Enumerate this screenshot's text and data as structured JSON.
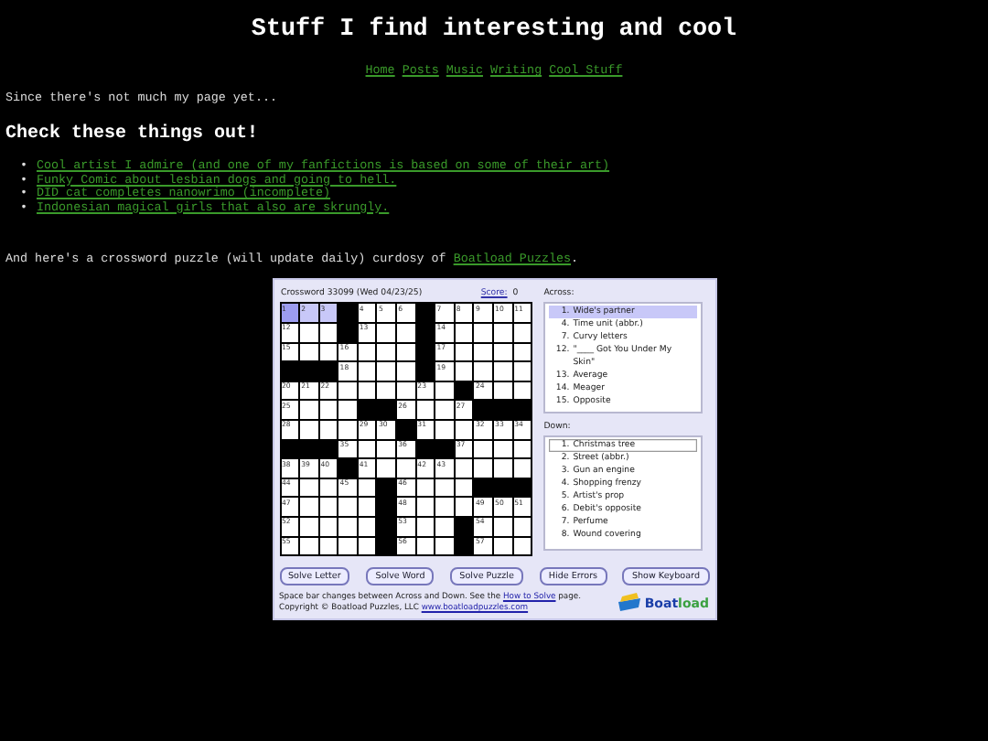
{
  "title": "Stuff I find interesting and cool",
  "nav": [
    "Home",
    "Posts",
    "Music",
    "Writing",
    "Cool Stuff"
  ],
  "intro": "Since there's not much my page yet...",
  "heading": "Check these things out!",
  "bullet": "•",
  "links": [
    "Cool artist I admire (and one of my fanfictions is based on some of their art)",
    "Funky Comic about lesbian dogs and going to hell.",
    "DID cat completes nanowrimo (incomplete)",
    "Indonesian magical girls that also are skrungly."
  ],
  "credit": {
    "text": "And here's a crossword puzzle (will update daily) curdosy of ",
    "link": "Boatload Puzzles",
    "after": "."
  },
  "crossword": {
    "title": "Crossword 33099 (Wed 04/23/25)",
    "score_label": "Score:",
    "score": "0",
    "grid": [
      [
        {
          "kind": "cursor",
          "number": "1"
        },
        {
          "kind": "word",
          "number": "2"
        },
        {
          "kind": "word",
          "number": "3"
        },
        {
          "kind": "black"
        },
        {
          "kind": "white",
          "number": "4"
        },
        {
          "kind": "white",
          "number": "5"
        },
        {
          "kind": "white",
          "number": "6"
        },
        {
          "kind": "black"
        },
        {
          "kind": "white",
          "number": "7"
        },
        {
          "kind": "white",
          "number": "8"
        },
        {
          "kind": "white",
          "number": "9"
        },
        {
          "kind": "white",
          "number": "10"
        },
        {
          "kind": "white",
          "number": "11"
        }
      ],
      [
        {
          "kind": "white",
          "number": "12"
        },
        {
          "kind": "white"
        },
        {
          "kind": "white"
        },
        {
          "kind": "black"
        },
        {
          "kind": "white",
          "number": "13"
        },
        {
          "kind": "white"
        },
        {
          "kind": "white"
        },
        {
          "kind": "black"
        },
        {
          "kind": "white",
          "number": "14"
        },
        {
          "kind": "white"
        },
        {
          "kind": "white"
        },
        {
          "kind": "white"
        },
        {
          "kind": "white"
        }
      ],
      [
        {
          "kind": "white",
          "number": "15"
        },
        {
          "kind": "white"
        },
        {
          "kind": "white"
        },
        {
          "kind": "white",
          "number": "16"
        },
        {
          "kind": "white"
        },
        {
          "kind": "white"
        },
        {
          "kind": "white"
        },
        {
          "kind": "black"
        },
        {
          "kind": "white",
          "number": "17"
        },
        {
          "kind": "white"
        },
        {
          "kind": "white"
        },
        {
          "kind": "white"
        },
        {
          "kind": "white"
        }
      ],
      [
        {
          "kind": "black"
        },
        {
          "kind": "black"
        },
        {
          "kind": "black"
        },
        {
          "kind": "white",
          "number": "18"
        },
        {
          "kind": "white"
        },
        {
          "kind": "white"
        },
        {
          "kind": "white"
        },
        {
          "kind": "black"
        },
        {
          "kind": "white",
          "number": "19"
        },
        {
          "kind": "white"
        },
        {
          "kind": "white"
        },
        {
          "kind": "white"
        },
        {
          "kind": "white"
        }
      ],
      [
        {
          "kind": "white",
          "number": "20"
        },
        {
          "kind": "white",
          "number": "21"
        },
        {
          "kind": "white",
          "number": "22"
        },
        {
          "kind": "white"
        },
        {
          "kind": "white"
        },
        {
          "kind": "white"
        },
        {
          "kind": "white"
        },
        {
          "kind": "white",
          "number": "23"
        },
        {
          "kind": "white"
        },
        {
          "kind": "black"
        },
        {
          "kind": "white",
          "number": "24"
        },
        {
          "kind": "white"
        },
        {
          "kind": "white"
        }
      ],
      [
        {
          "kind": "white",
          "number": "25"
        },
        {
          "kind": "white"
        },
        {
          "kind": "white"
        },
        {
          "kind": "white"
        },
        {
          "kind": "black"
        },
        {
          "kind": "black"
        },
        {
          "kind": "white",
          "number": "26"
        },
        {
          "kind": "white"
        },
        {
          "kind": "white"
        },
        {
          "kind": "white",
          "number": "27"
        },
        {
          "kind": "black"
        },
        {
          "kind": "black"
        },
        {
          "kind": "black"
        }
      ],
      [
        {
          "kind": "white",
          "number": "28"
        },
        {
          "kind": "white"
        },
        {
          "kind": "white"
        },
        {
          "kind": "white"
        },
        {
          "kind": "white",
          "number": "29"
        },
        {
          "kind": "white",
          "number": "30"
        },
        {
          "kind": "black"
        },
        {
          "kind": "white",
          "number": "31"
        },
        {
          "kind": "white"
        },
        {
          "kind": "white"
        },
        {
          "kind": "white",
          "number": "32"
        },
        {
          "kind": "white",
          "number": "33"
        },
        {
          "kind": "white",
          "number": "34"
        }
      ],
      [
        {
          "kind": "black"
        },
        {
          "kind": "black"
        },
        {
          "kind": "black"
        },
        {
          "kind": "white",
          "number": "35"
        },
        {
          "kind": "white"
        },
        {
          "kind": "white"
        },
        {
          "kind": "white",
          "number": "36"
        },
        {
          "kind": "black"
        },
        {
          "kind": "black"
        },
        {
          "kind": "white",
          "number": "37"
        },
        {
          "kind": "white"
        },
        {
          "kind": "white"
        },
        {
          "kind": "white"
        }
      ],
      [
        {
          "kind": "white",
          "number": "38"
        },
        {
          "kind": "white",
          "number": "39"
        },
        {
          "kind": "white",
          "number": "40"
        },
        {
          "kind": "black"
        },
        {
          "kind": "white",
          "number": "41"
        },
        {
          "kind": "white"
        },
        {
          "kind": "white"
        },
        {
          "kind": "white",
          "number": "42"
        },
        {
          "kind": "white",
          "number": "43"
        },
        {
          "kind": "white"
        },
        {
          "kind": "white"
        },
        {
          "kind": "white"
        },
        {
          "kind": "white"
        }
      ],
      [
        {
          "kind": "white",
          "number": "44"
        },
        {
          "kind": "white"
        },
        {
          "kind": "white"
        },
        {
          "kind": "white",
          "number": "45"
        },
        {
          "kind": "white"
        },
        {
          "kind": "black"
        },
        {
          "kind": "white",
          "number": "46"
        },
        {
          "kind": "white"
        },
        {
          "kind": "white"
        },
        {
          "kind": "white"
        },
        {
          "kind": "black"
        },
        {
          "kind": "black"
        },
        {
          "kind": "black"
        }
      ],
      [
        {
          "kind": "white",
          "number": "47"
        },
        {
          "kind": "white"
        },
        {
          "kind": "white"
        },
        {
          "kind": "white"
        },
        {
          "kind": "white"
        },
        {
          "kind": "black"
        },
        {
          "kind": "white",
          "number": "48"
        },
        {
          "kind": "white"
        },
        {
          "kind": "white"
        },
        {
          "kind": "white"
        },
        {
          "kind": "white",
          "number": "49"
        },
        {
          "kind": "white",
          "number": "50"
        },
        {
          "kind": "white",
          "number": "51"
        }
      ],
      [
        {
          "kind": "white",
          "number": "52"
        },
        {
          "kind": "white"
        },
        {
          "kind": "white"
        },
        {
          "kind": "white"
        },
        {
          "kind": "white"
        },
        {
          "kind": "black"
        },
        {
          "kind": "white",
          "number": "53"
        },
        {
          "kind": "white"
        },
        {
          "kind": "white"
        },
        {
          "kind": "black"
        },
        {
          "kind": "white",
          "number": "54"
        },
        {
          "kind": "white"
        },
        {
          "kind": "white"
        }
      ],
      [
        {
          "kind": "white",
          "number": "55"
        },
        {
          "kind": "white"
        },
        {
          "kind": "white"
        },
        {
          "kind": "white"
        },
        {
          "kind": "white"
        },
        {
          "kind": "black"
        },
        {
          "kind": "white",
          "number": "56"
        },
        {
          "kind": "white"
        },
        {
          "kind": "white"
        },
        {
          "kind": "black"
        },
        {
          "kind": "white",
          "number": "57"
        },
        {
          "kind": "white"
        },
        {
          "kind": "white"
        }
      ]
    ],
    "across": {
      "label": "Across:",
      "clues": [
        {
          "number": "1.",
          "text": "Wide's partner",
          "selected": true
        },
        {
          "number": "4.",
          "text": "Time unit (abbr.)",
          "selected": false
        },
        {
          "number": "7.",
          "text": "Curvy letters",
          "selected": false
        },
        {
          "number": "12.",
          "text": "\"____ Got You Under My Skin\"",
          "selected": false
        },
        {
          "number": "13.",
          "text": "Average",
          "selected": false
        },
        {
          "number": "14.",
          "text": "Meager",
          "selected": false
        },
        {
          "number": "15.",
          "text": "Opposite",
          "selected": false
        }
      ]
    },
    "down": {
      "label": "Down:",
      "clues": [
        {
          "number": "1.",
          "text": "Christmas tree",
          "selected": true
        },
        {
          "number": "2.",
          "text": "Street (abbr.)",
          "selected": false
        },
        {
          "number": "3.",
          "text": "Gun an engine",
          "selected": false
        },
        {
          "number": "4.",
          "text": "Shopping frenzy",
          "selected": false
        },
        {
          "number": "5.",
          "text": "Artist's prop",
          "selected": false
        },
        {
          "number": "6.",
          "text": "Debit's opposite",
          "selected": false
        },
        {
          "number": "7.",
          "text": "Perfume",
          "selected": false
        },
        {
          "number": "8.",
          "text": "Wound covering",
          "selected": false
        }
      ]
    },
    "buttons": [
      "Solve Letter",
      "Solve Word",
      "Solve Puzzle",
      "Hide Errors",
      "Show Keyboard"
    ],
    "help": {
      "text": "Space bar changes between Across and Down. See the ",
      "link": "How to Solve",
      "after": " page."
    },
    "copyright": {
      "text": "Copyright © Boatload Puzzles, LLC ",
      "link": "www.boatloadpuzzles.com"
    },
    "logo": [
      "Boat",
      "load"
    ]
  }
}
